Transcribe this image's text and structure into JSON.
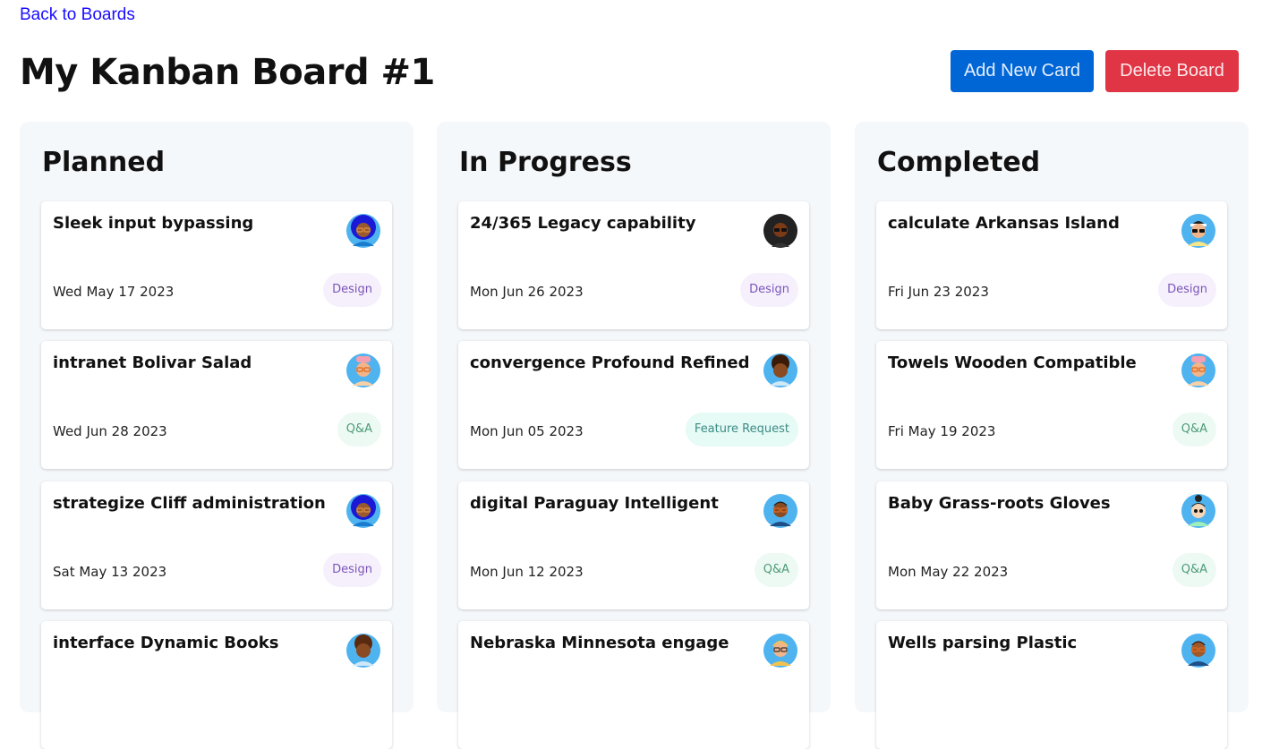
{
  "nav": {
    "back_label": "Back to Boards"
  },
  "board": {
    "title": "My Kanban Board #1"
  },
  "actions": {
    "add_label": "Add New Card",
    "delete_label": "Delete Board"
  },
  "colors": {
    "primary": "#0066d6",
    "danger": "#e03545",
    "column_bg": "#f5f8fb",
    "link": "#1a0dff"
  },
  "columns": [
    {
      "title": "Planned",
      "cards": [
        {
          "title": "Sleek input bypassing",
          "date": "Wed May 17 2023",
          "tag": "Design",
          "avatar": "avatar-dark-blue-hair-icon"
        },
        {
          "title": "intranet Bolivar Salad",
          "date": "Wed Jun 28 2023",
          "tag": "Q&A",
          "avatar": "avatar-pink-hair-icon"
        },
        {
          "title": "strategize Cliff administration",
          "date": "Sat May 13 2023",
          "tag": "Design",
          "avatar": "avatar-dark-blue-hair-icon"
        },
        {
          "title": "interface Dynamic Books",
          "date": "",
          "tag": "",
          "avatar": "avatar-curly-hair-icon"
        }
      ]
    },
    {
      "title": "In Progress",
      "cards": [
        {
          "title": "24/365 Legacy capability",
          "date": "Mon Jun 26 2023",
          "tag": "Design",
          "avatar": "avatar-long-hair-icon"
        },
        {
          "title": "convergence Profound Refined",
          "date": "Mon Jun 05 2023",
          "tag": "Feature Request",
          "avatar": "avatar-curly-hair-icon"
        },
        {
          "title": "digital Paraguay Intelligent",
          "date": "Mon Jun 12 2023",
          "tag": "Q&A",
          "avatar": "avatar-short-hair-icon"
        },
        {
          "title": "Nebraska Minnesota engage",
          "date": "",
          "tag": "",
          "avatar": "avatar-blond-hair-icon"
        }
      ]
    },
    {
      "title": "Completed",
      "cards": [
        {
          "title": "calculate Arkansas Island",
          "date": "Fri Jun 23 2023",
          "tag": "Design",
          "avatar": "avatar-headband-icon"
        },
        {
          "title": "Towels Wooden Compatible",
          "date": "Fri May 19 2023",
          "tag": "Q&A",
          "avatar": "avatar-pink-hair-icon"
        },
        {
          "title": "Baby Grass-roots Gloves",
          "date": "Mon May 22 2023",
          "tag": "Q&A",
          "avatar": "avatar-bun-hair-icon"
        },
        {
          "title": "Wells parsing Plastic",
          "date": "",
          "tag": "",
          "avatar": "avatar-short-hair-icon"
        }
      ]
    }
  ]
}
